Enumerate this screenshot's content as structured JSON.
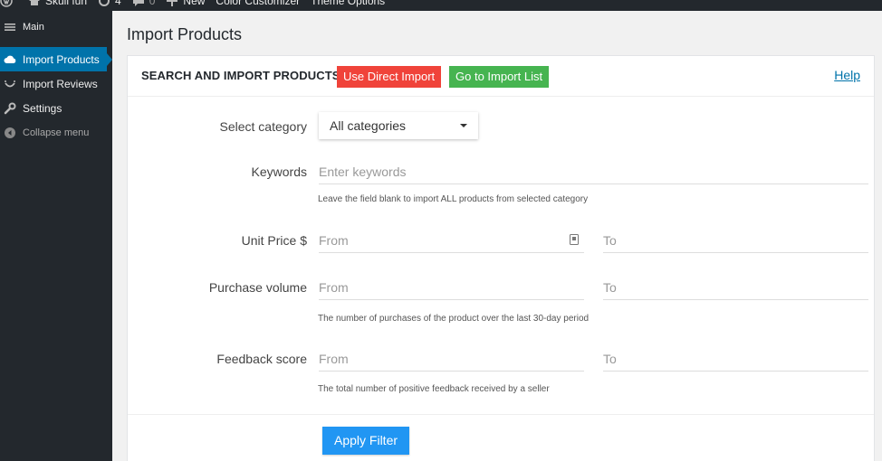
{
  "adminbar": {
    "site_name": "Skull fun",
    "updates_count": "4",
    "comments_count": "0",
    "new_label": "New",
    "color_customizer": "Color Customizer",
    "theme_options": "Theme Options"
  },
  "sidebar": {
    "items": [
      {
        "label": "Main",
        "icon": "menu-icon"
      },
      {
        "label": "Import Products",
        "icon": "cloud-icon",
        "active": true
      },
      {
        "label": "Import Reviews",
        "icon": "smile-icon"
      },
      {
        "label": "Settings",
        "icon": "wrench-icon"
      },
      {
        "label": "Collapse menu",
        "icon": "collapse-icon"
      }
    ]
  },
  "page": {
    "title": "Import Products"
  },
  "panel": {
    "title": "SEARCH AND IMPORT PRODUCTS",
    "direct_import_label": "Use Direct Import",
    "import_list_label": "Go to Import List",
    "help_label": "Help"
  },
  "form": {
    "category_label": "Select category",
    "category_value": "All categories",
    "keywords_label": "Keywords",
    "keywords_placeholder": "Enter keywords",
    "keywords_hint": "Leave the field blank to import ALL products from selected category",
    "unit_price_label": "Unit Price $",
    "purchase_volume_label": "Purchase volume",
    "purchase_volume_hint": "The number of purchases of the product over the last 30-day period",
    "feedback_label": "Feedback score",
    "feedback_hint": "The total number of positive feedback received by a seller",
    "from_placeholder": "From",
    "to_placeholder": "To",
    "apply_label": "Apply Filter"
  },
  "colors": {
    "sidebar_bg": "#23282d",
    "active_blue": "#0073aa",
    "red": "#f0433a",
    "green": "#46b450",
    "apply_blue": "#2196f3"
  }
}
